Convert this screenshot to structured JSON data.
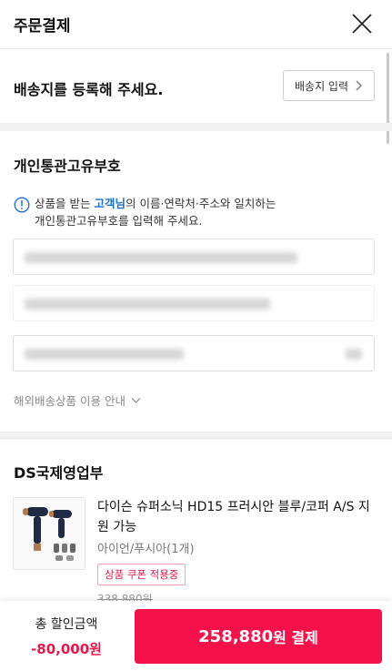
{
  "header": {
    "title": "주문결제"
  },
  "address": {
    "prompt": "배송지를 등록해 주세요.",
    "button_label": "배송지 입력"
  },
  "customs": {
    "title": "개인통관고유부호",
    "notice_prefix": "상품을 받는 ",
    "notice_highlight": "고객님",
    "notice_suffix": "의 이름·연락처·주소와 일치하는",
    "notice_line2": "개인통관고유부호를 입력해 주세요.",
    "overseas_guide": "해외배송상품 이용 안내"
  },
  "seller": {
    "name": "DS국제영업부",
    "product": {
      "name": "다이슨 슈퍼소닉 HD15 프러시안 블루/코퍼 A/S 지원 가능",
      "option": "아이언/푸시아(1개)",
      "coupon_badge": "상품 쿠폰 적용중",
      "original_price": "338,880원"
    }
  },
  "bottom": {
    "discount_label": "총 할인금액",
    "discount_value": "-80,000원",
    "pay_amount": "258,880",
    "pay_suffix": "원 결제"
  },
  "colors": {
    "accent": "#f7114a",
    "link": "#1a6fd0",
    "discount": "#e8174a"
  }
}
